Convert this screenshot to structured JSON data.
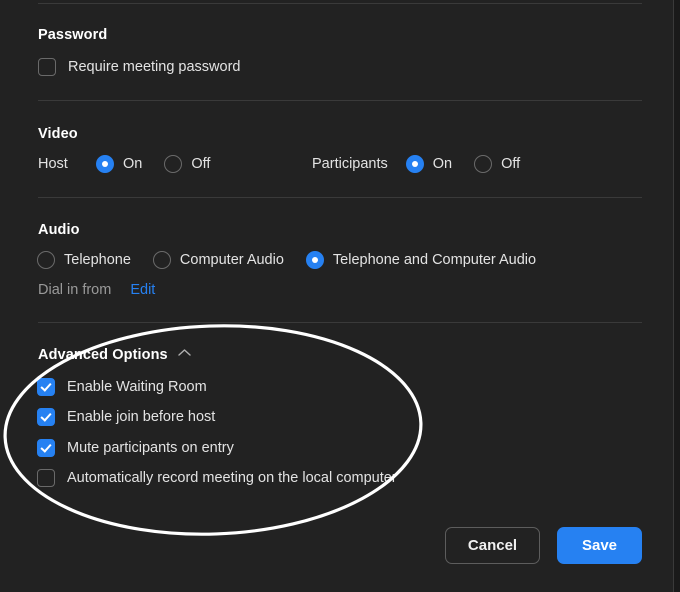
{
  "dialog": {
    "background_color": "#222222",
    "accent_color": "#2681f2"
  },
  "sections": {
    "password": {
      "title": "Password",
      "checkbox": {
        "label": "Require meeting password",
        "checked": false
      }
    },
    "video": {
      "title": "Video",
      "host": {
        "label": "Host",
        "options": [
          "On",
          "Off"
        ],
        "selected": "On"
      },
      "participants": {
        "label": "Participants",
        "options": [
          "On",
          "Off"
        ],
        "selected": "On"
      }
    },
    "audio": {
      "title": "Audio",
      "options": [
        "Telephone",
        "Computer Audio",
        "Telephone and Computer Audio"
      ],
      "selected": "Telephone and Computer Audio",
      "dial_in_label": "Dial in from",
      "edit_link": "Edit"
    },
    "advanced": {
      "title": "Advanced Options",
      "chevron_icon": "chevron-up-icon",
      "expanded": true,
      "checkboxes": [
        {
          "label": "Enable Waiting Room",
          "checked": true
        },
        {
          "label": "Enable join before host",
          "checked": true
        },
        {
          "label": "Mute participants on entry",
          "checked": true
        },
        {
          "label": "Automatically record meeting on the local computer",
          "checked": false
        }
      ]
    }
  },
  "footer": {
    "cancel_label": "Cancel",
    "save_label": "Save"
  },
  "annotation": {
    "type": "ellipse-highlight",
    "color": "#ffffff"
  }
}
